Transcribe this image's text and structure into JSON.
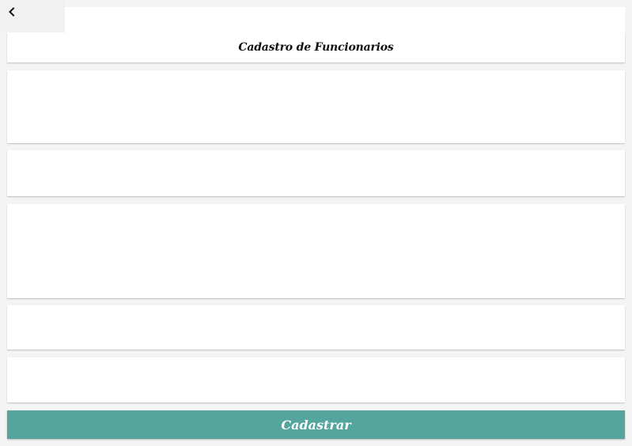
{
  "header": {
    "back_icon": "chevron-left-icon",
    "title": "Cadastro de Funcionarios"
  },
  "form": {
    "fields": [
      {
        "value": "",
        "placeholder": ""
      },
      {
        "value": "",
        "placeholder": ""
      },
      {
        "value": "",
        "placeholder": ""
      },
      {
        "value": "",
        "placeholder": ""
      },
      {
        "value": "",
        "placeholder": ""
      }
    ],
    "submit_label": "Cadastrar"
  },
  "colors": {
    "accent": "#53a59e",
    "background": "#f4f4f4",
    "card": "#ffffff"
  }
}
